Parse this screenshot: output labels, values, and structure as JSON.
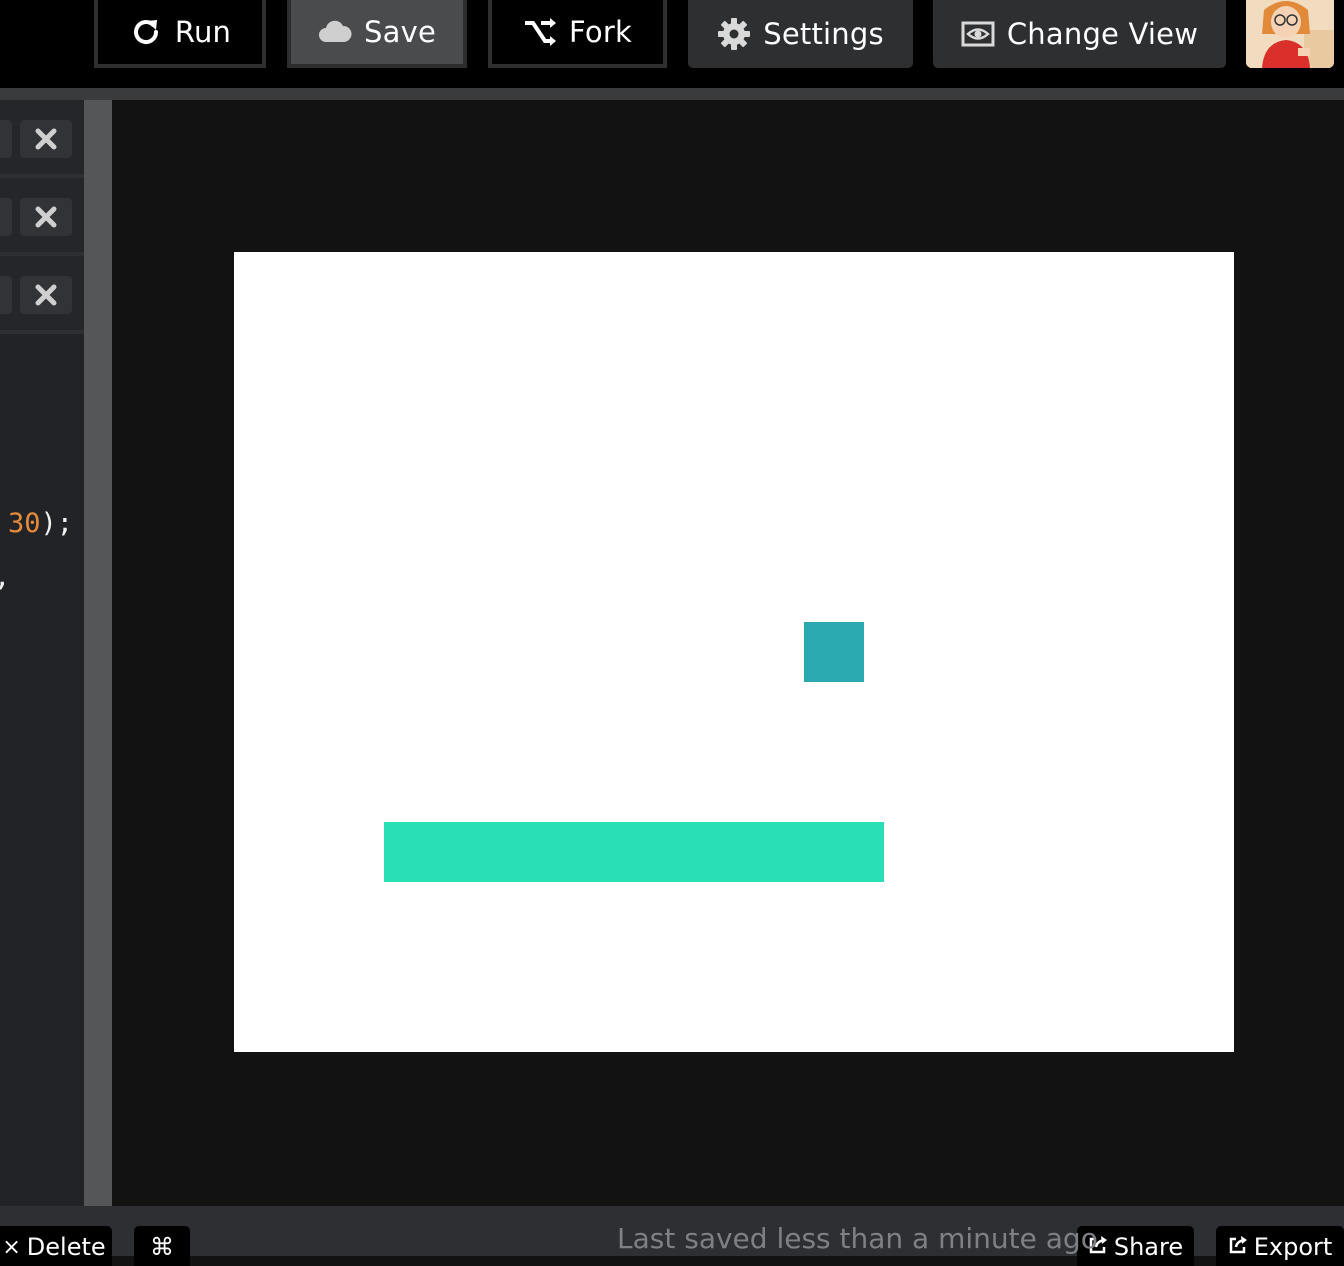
{
  "toolbar": {
    "run_label": "Run",
    "save_label": "Save",
    "fork_label": "Fork",
    "settings_label": "Settings",
    "change_view_label": "Change View"
  },
  "editor": {
    "visible_code": {
      "number": "30",
      "punctuation": ");",
      "fragment": ","
    },
    "file_tabs": [
      {
        "close_icon": "close-icon"
      },
      {
        "close_icon": "close-icon"
      },
      {
        "close_icon": "close-icon"
      }
    ]
  },
  "preview": {
    "canvas_color": "#ffffff",
    "square_color": "#2aa9b0",
    "paddle_color": "#29dfb5"
  },
  "bottom_bar": {
    "delete_label": "Delete",
    "shortcuts_symbol": "⌘",
    "save_status": "Last saved less than a minute ago",
    "share_label": "Share",
    "export_label": "Export"
  },
  "colors": {
    "toolbar_bg": "#000000",
    "code_number": "#e58b3c",
    "page_bg": "#121212"
  }
}
